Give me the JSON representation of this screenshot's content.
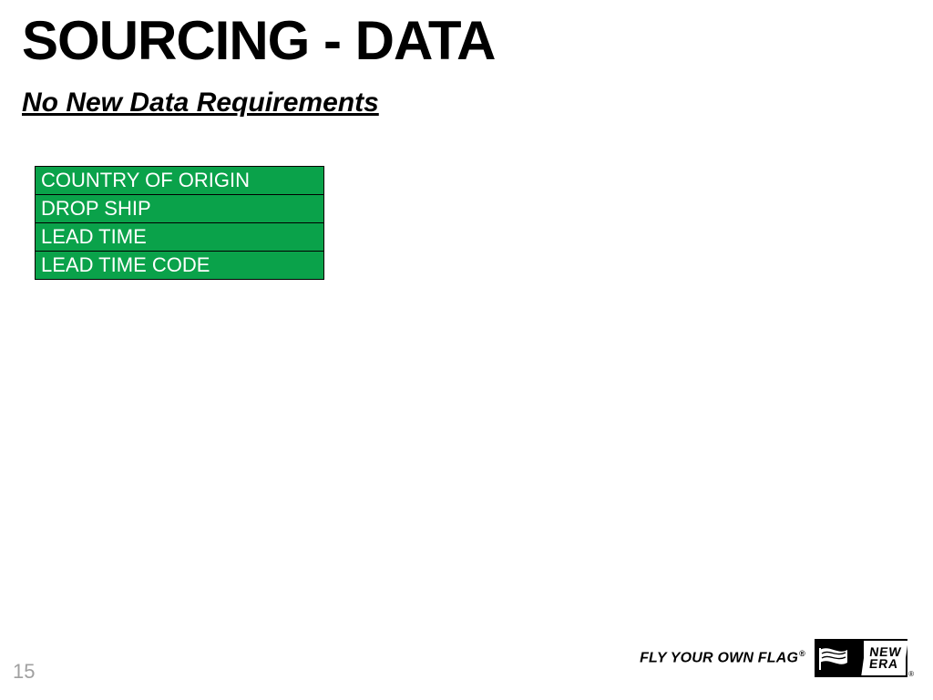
{
  "slide": {
    "title": "SOURCING - DATA",
    "subtitle": "No New Data Requirements",
    "page_number": "15"
  },
  "fields": [
    "COUNTRY OF ORIGIN",
    "DROP SHIP",
    "LEAD TIME",
    "LEAD TIME CODE"
  ],
  "footer": {
    "tagline": "FLY YOUR OWN FLAG",
    "register_mark": "®",
    "brand_line1": "NEW",
    "brand_line2": "ERA"
  },
  "colors": {
    "table_green": "#0aa24a"
  }
}
